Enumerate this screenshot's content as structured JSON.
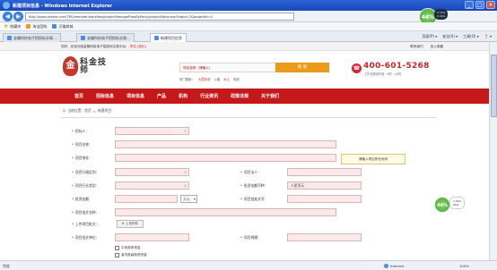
{
  "window": {
    "title": "新建项目信息 - Windows Internet Explorer",
    "url": "http://www.jinkeid.com/TRS/member/workflow/projectManageFlowByParty/projectEditor.asp?tabId=2&projectId=0",
    "go_label": "→"
  },
  "favorites": {
    "label": "收藏夹",
    "items": [
      "淘宝团购",
      "天猫商城"
    ]
  },
  "tabs": [
    {
      "label": "金蝶科技电子招投标交易..."
    },
    {
      "label": "金蝶科技电子招投标交易..."
    },
    {
      "label": "新建项目信息"
    }
  ],
  "toolbar_right": [
    "页面(P) ▾",
    "安全(S) ▾",
    "工具(O) ▾",
    "❓ ▾"
  ],
  "topbar": {
    "welcome": "您好，欢迎光临金蝶科技电子招投标交易平台！",
    "user": "李佳 [退出]",
    "links": [
      "联系我们",
      "加入收藏"
    ]
  },
  "header": {
    "logo_seal_char": "金",
    "logo_text": "科金技师",
    "search_placeholder": "项目名称（请输入）",
    "search_button": "搜  索",
    "hotwords_label": "热门搜索：",
    "hotwords": [
      "大荔抢收",
      "公路",
      "水土",
      "电改"
    ],
    "phone": "400-601-5268",
    "phone_sub": "工作日服务时间：9时 - 18时"
  },
  "nav": {
    "items": [
      "首页",
      "招标信息",
      "项目信息",
      "产品",
      "机构",
      "行业资讯",
      "政策法规",
      "关于我们"
    ]
  },
  "breadcrumb": {
    "items": [
      "当前位置：首页",
      ">",
      "新建项目"
    ]
  },
  "form": {
    "fields": {
      "applicant": "招标人：",
      "project_name": "项目名称：",
      "project_address": "项目地址：",
      "region": "项目行政区划：",
      "legal_person": "项目法人：",
      "industry": "项目行业类型：",
      "investment_currency": "投资金额币种：",
      "investment_amount": "投资金额：",
      "approval_number": "项目批准文号：",
      "project_docs": "项目批文名称：",
      "upload_approval": "上传项目批文：",
      "approval_unit": "项目批文单位：",
      "scale": "项目规模："
    },
    "currency_value": "人民币元",
    "unit_value": "万元",
    "upload_button": "上传附件",
    "tip": "请输入项目所在地详",
    "funding_options": [
      "中央政府资金",
      "省内各级政府资金"
    ]
  },
  "speed_widget": {
    "percent_top": "44%",
    "percent_bottom": "44%",
    "stat_up_top": "0.7K/s",
    "stat_down_top": "0.2K/s",
    "stat_up_bottom": "1.5K/s",
    "stat_down_bottom": "0K/s"
  },
  "status": {
    "left": "完成",
    "zone": "Internet",
    "zoom": "100%"
  }
}
